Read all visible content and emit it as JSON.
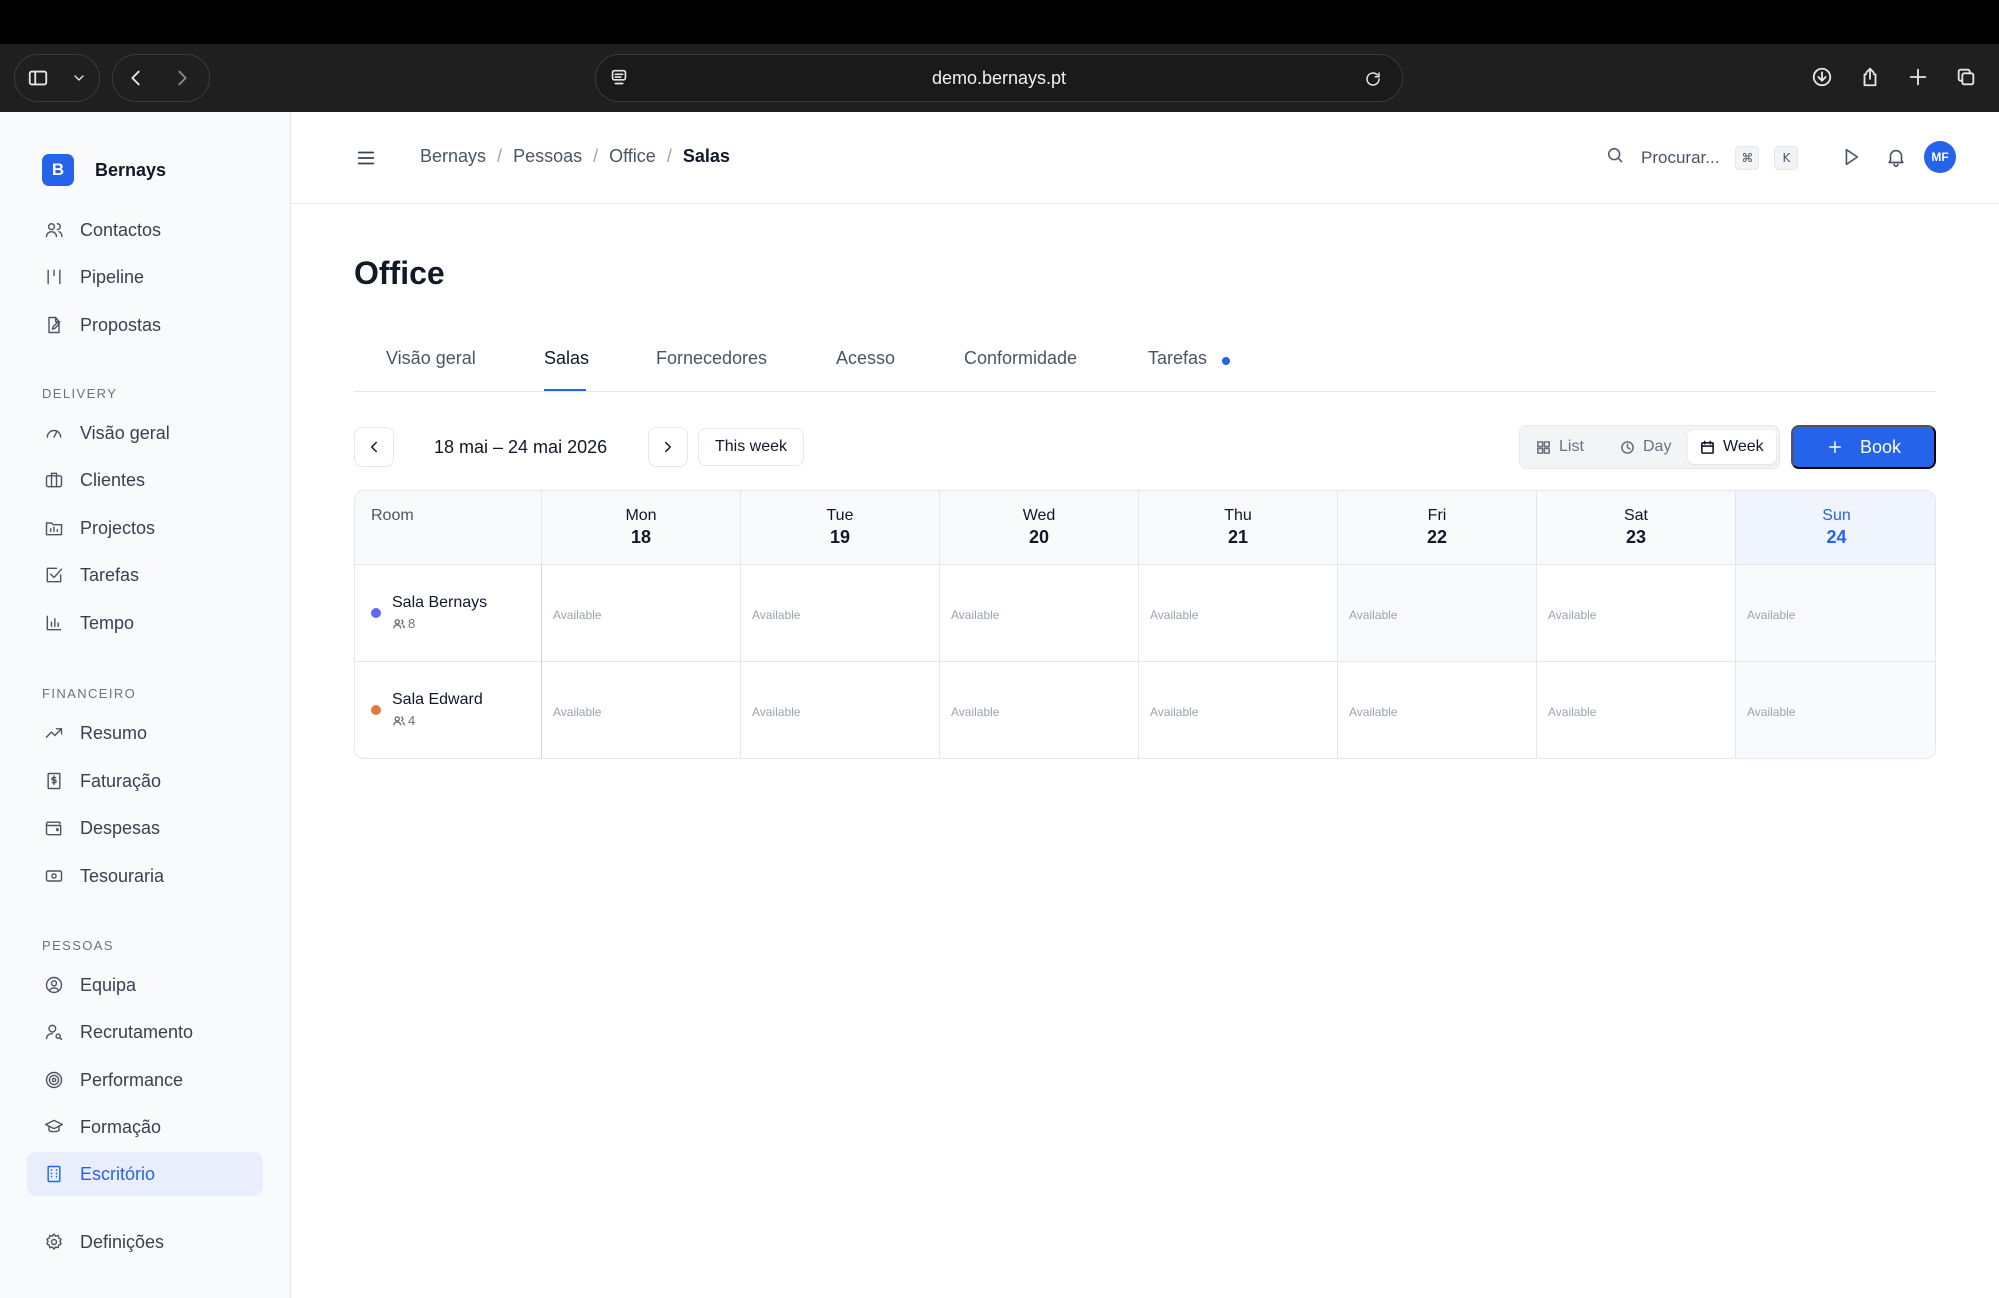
{
  "browser": {
    "url": "demo.bernays.pt"
  },
  "sidebar": {
    "brand_initial": "B",
    "brand_name": "Bernays",
    "top_items": [
      {
        "label": "Contactos",
        "icon": "users-icon"
      },
      {
        "label": "Pipeline",
        "icon": "pipeline-icon"
      },
      {
        "label": "Propostas",
        "icon": "file-edit-icon"
      }
    ],
    "sections": [
      {
        "title": "DELIVERY",
        "items": [
          {
            "label": "Visão geral",
            "icon": "gauge-icon"
          },
          {
            "label": "Clientes",
            "icon": "briefcase-icon"
          },
          {
            "label": "Projectos",
            "icon": "folder-icon"
          },
          {
            "label": "Tarefas",
            "icon": "checkbox-icon"
          },
          {
            "label": "Tempo",
            "icon": "bar-chart-icon"
          }
        ]
      },
      {
        "title": "FINANCEIRO",
        "items": [
          {
            "label": "Resumo",
            "icon": "trending-up-icon"
          },
          {
            "label": "Faturação",
            "icon": "invoice-icon"
          },
          {
            "label": "Despesas",
            "icon": "wallet-icon"
          },
          {
            "label": "Tesouraria",
            "icon": "banknote-icon"
          }
        ]
      },
      {
        "title": "PESSOAS",
        "items": [
          {
            "label": "Equipa",
            "icon": "user-circle-icon"
          },
          {
            "label": "Recrutamento",
            "icon": "user-search-icon"
          },
          {
            "label": "Performance",
            "icon": "target-icon"
          },
          {
            "label": "Formação",
            "icon": "graduation-cap-icon"
          },
          {
            "label": "Escritório",
            "icon": "building-icon",
            "active": true
          }
        ]
      }
    ],
    "settings_label": "Definições"
  },
  "header": {
    "breadcrumb": [
      "Bernays",
      "Pessoas",
      "Office",
      "Salas"
    ],
    "search_placeholder": "Procurar...",
    "shortcut_keys": [
      "⌘",
      "K"
    ],
    "avatar_initials": "MF"
  },
  "page": {
    "title": "Office",
    "tabs": [
      "Visão geral",
      "Salas",
      "Fornecedores",
      "Acesso",
      "Conformidade",
      "Tarefas"
    ],
    "active_tab": "Salas"
  },
  "toolbar": {
    "date_range": "18 mai – 24 mai 2026",
    "this_week_label": "This week",
    "views": [
      "List",
      "Day",
      "Week"
    ],
    "active_view": "Week",
    "book_label": "Book"
  },
  "calendar": {
    "room_header": "Room",
    "days": [
      {
        "name": "Mon",
        "date": "18"
      },
      {
        "name": "Tue",
        "date": "19"
      },
      {
        "name": "Wed",
        "date": "20"
      },
      {
        "name": "Thu",
        "date": "21"
      },
      {
        "name": "Fri",
        "date": "22"
      },
      {
        "name": "Sat",
        "date": "23"
      },
      {
        "name": "Sun",
        "date": "24",
        "today": true
      }
    ],
    "rooms": [
      {
        "name": "Sala Bernays",
        "capacity": "8",
        "color": "#6366f1"
      },
      {
        "name": "Sala Edward",
        "capacity": "4",
        "color": "#e07a3f"
      }
    ],
    "cell_label": "Available",
    "accent_color": "#2563eb"
  }
}
